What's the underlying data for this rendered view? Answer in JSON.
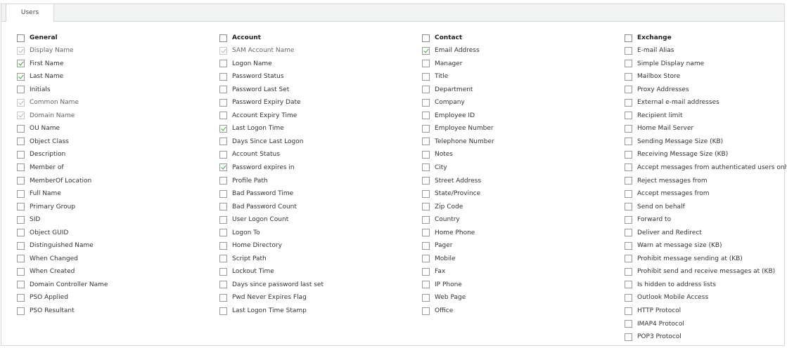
{
  "tab": {
    "label": "Users"
  },
  "columns": [
    {
      "header": "General",
      "items": [
        {
          "label": "Display Name",
          "state": "disabled"
        },
        {
          "label": "First Name",
          "state": "checked"
        },
        {
          "label": "Last Name",
          "state": "checked"
        },
        {
          "label": "Initials",
          "state": "unchecked"
        },
        {
          "label": "Common Name",
          "state": "disabled"
        },
        {
          "label": "Domain Name",
          "state": "disabled"
        },
        {
          "label": "OU Name",
          "state": "unchecked"
        },
        {
          "label": "Object Class",
          "state": "unchecked"
        },
        {
          "label": "Description",
          "state": "unchecked"
        },
        {
          "label": "Member of",
          "state": "unchecked"
        },
        {
          "label": "MemberOf Location",
          "state": "unchecked"
        },
        {
          "label": "Full Name",
          "state": "unchecked"
        },
        {
          "label": "Primary Group",
          "state": "unchecked"
        },
        {
          "label": "SID",
          "state": "unchecked"
        },
        {
          "label": "Object GUID",
          "state": "unchecked"
        },
        {
          "label": "Distinguished Name",
          "state": "unchecked"
        },
        {
          "label": "When Changed",
          "state": "unchecked"
        },
        {
          "label": "When Created",
          "state": "unchecked"
        },
        {
          "label": "Domain Controller Name",
          "state": "unchecked"
        },
        {
          "label": "PSO Applied",
          "state": "unchecked"
        },
        {
          "label": "PSO Resultant",
          "state": "unchecked"
        }
      ]
    },
    {
      "header": "Account",
      "items": [
        {
          "label": "SAM Account Name",
          "state": "disabled"
        },
        {
          "label": "Logon Name",
          "state": "unchecked"
        },
        {
          "label": "Password Status",
          "state": "unchecked"
        },
        {
          "label": "Password Last Set",
          "state": "unchecked"
        },
        {
          "label": "Password Expiry Date",
          "state": "unchecked"
        },
        {
          "label": "Account Expiry Time",
          "state": "unchecked"
        },
        {
          "label": "Last Logon Time",
          "state": "checked"
        },
        {
          "label": "Days Since Last Logon",
          "state": "unchecked"
        },
        {
          "label": "Account Status",
          "state": "unchecked"
        },
        {
          "label": "Password expires in",
          "state": "checked"
        },
        {
          "label": "Profile Path",
          "state": "unchecked"
        },
        {
          "label": "Bad Password Time",
          "state": "unchecked"
        },
        {
          "label": "Bad Password Count",
          "state": "unchecked"
        },
        {
          "label": "User Logon Count",
          "state": "unchecked"
        },
        {
          "label": "Logon To",
          "state": "unchecked"
        },
        {
          "label": "Home Directory",
          "state": "unchecked"
        },
        {
          "label": "Script Path",
          "state": "unchecked"
        },
        {
          "label": "Lockout Time",
          "state": "unchecked"
        },
        {
          "label": "Days since password last set",
          "state": "unchecked"
        },
        {
          "label": "Pwd Never Expires Flag",
          "state": "unchecked"
        },
        {
          "label": "Last Logon Time Stamp",
          "state": "unchecked"
        }
      ]
    },
    {
      "header": "Contact",
      "items": [
        {
          "label": "Email Address",
          "state": "checked"
        },
        {
          "label": "Manager",
          "state": "unchecked"
        },
        {
          "label": "Title",
          "state": "unchecked"
        },
        {
          "label": "Department",
          "state": "unchecked"
        },
        {
          "label": "Company",
          "state": "unchecked"
        },
        {
          "label": "Employee ID",
          "state": "unchecked"
        },
        {
          "label": "Employee Number",
          "state": "unchecked"
        },
        {
          "label": "Telephone Number",
          "state": "unchecked"
        },
        {
          "label": "Notes",
          "state": "unchecked"
        },
        {
          "label": "City",
          "state": "unchecked"
        },
        {
          "label": "Street Address",
          "state": "unchecked"
        },
        {
          "label": "State/Province",
          "state": "unchecked"
        },
        {
          "label": "Zip Code",
          "state": "unchecked"
        },
        {
          "label": "Country",
          "state": "unchecked"
        },
        {
          "label": "Home Phone",
          "state": "unchecked"
        },
        {
          "label": "Pager",
          "state": "unchecked"
        },
        {
          "label": "Mobile",
          "state": "unchecked"
        },
        {
          "label": "Fax",
          "state": "unchecked"
        },
        {
          "label": "IP Phone",
          "state": "unchecked"
        },
        {
          "label": "Web Page",
          "state": "unchecked"
        },
        {
          "label": "Office",
          "state": "unchecked"
        }
      ]
    },
    {
      "header": "Exchange",
      "items": [
        {
          "label": "E-mail Alias",
          "state": "unchecked"
        },
        {
          "label": "Simple Display name",
          "state": "unchecked"
        },
        {
          "label": "Mailbox Store",
          "state": "unchecked"
        },
        {
          "label": "Proxy Addresses",
          "state": "unchecked"
        },
        {
          "label": "External e-mail addresses",
          "state": "unchecked"
        },
        {
          "label": "Recipient limit",
          "state": "unchecked"
        },
        {
          "label": "Home Mail Server",
          "state": "unchecked"
        },
        {
          "label": "Sending Message Size (KB)",
          "state": "unchecked"
        },
        {
          "label": "Receiving Message Size (KB)",
          "state": "unchecked"
        },
        {
          "label": "Accept messages from authenticated users only",
          "state": "unchecked"
        },
        {
          "label": "Reject messages from",
          "state": "unchecked"
        },
        {
          "label": "Accept messages from",
          "state": "unchecked"
        },
        {
          "label": "Send on behalf",
          "state": "unchecked"
        },
        {
          "label": "Forward to",
          "state": "unchecked"
        },
        {
          "label": "Deliver and Redirect",
          "state": "unchecked"
        },
        {
          "label": "Warn at message size (KB)",
          "state": "unchecked"
        },
        {
          "label": "Prohibit message sending at (KB)",
          "state": "unchecked"
        },
        {
          "label": "Prohibit send and receive messages at (KB)",
          "state": "unchecked"
        },
        {
          "label": "Is hidden to address lists",
          "state": "unchecked"
        },
        {
          "label": "Outlook Mobile Access",
          "state": "unchecked"
        },
        {
          "label": "HTTP Protocol",
          "state": "unchecked"
        },
        {
          "label": "IMAP4 Protocol",
          "state": "unchecked"
        },
        {
          "label": "POP3 Protocol",
          "state": "unchecked"
        }
      ]
    }
  ],
  "colors": {
    "check": "#3aa63a",
    "border": "#d6d6d6",
    "tabbar": "#f2f3f3"
  }
}
